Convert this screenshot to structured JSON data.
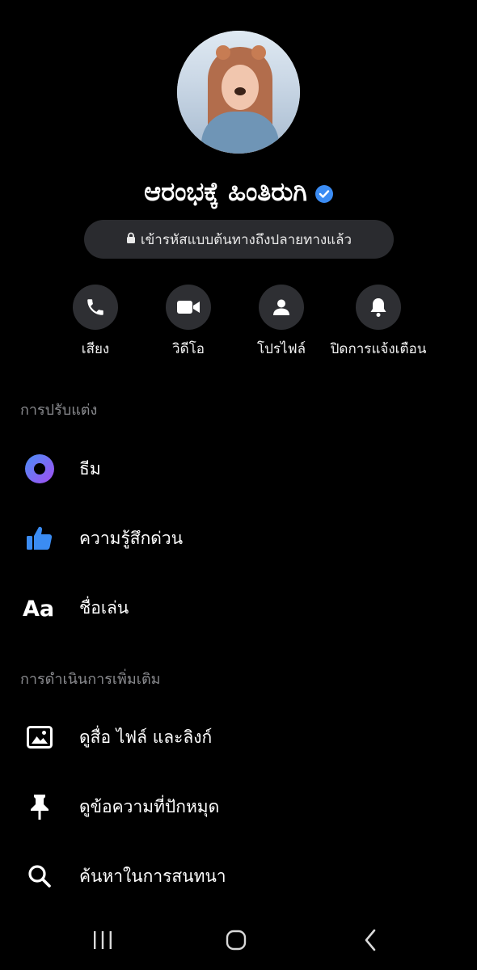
{
  "profile": {
    "name": "ಆರಂಭಕ್ಕೆ ಹಿಂತಿರುಗಿ",
    "encryption_label": "เข้ารหัสแบบต้นทางถึงปลายทางแล้ว",
    "verified_icon": "verified-badge-icon",
    "verified_color": "#3b8cf3"
  },
  "actions": [
    {
      "label": "เสียง",
      "icon": "phone-icon"
    },
    {
      "label": "วิดีโอ",
      "icon": "video-camera-icon"
    },
    {
      "label": "โปรไฟล์",
      "icon": "person-icon"
    },
    {
      "label": "ปิดการแจ้งเตือน",
      "icon": "bell-icon"
    }
  ],
  "sections": {
    "customize": "การปรับแต่ง",
    "more_actions": "การดำเนินการเพิ่มเติม"
  },
  "customize_items": [
    {
      "label": "ธีม",
      "icon": "theme-icon"
    },
    {
      "label": "ความรู้สึกด่วน",
      "icon": "thumbs-up-icon"
    },
    {
      "label": "ชื่อเล่น",
      "icon": "text-aa-icon"
    }
  ],
  "more_items": [
    {
      "label": "ดูสื่อ ไฟล์ และลิงก์",
      "icon": "image-icon"
    },
    {
      "label": "ดูข้อความที่ปักหมุด",
      "icon": "pin-icon"
    },
    {
      "label": "ค้นหาในการสนทนา",
      "icon": "search-icon"
    }
  ],
  "colors": {
    "background": "#000000",
    "accent": "#3b8cf3",
    "button_bg": "#2e2f33",
    "section_text": "#8a8b8f"
  }
}
